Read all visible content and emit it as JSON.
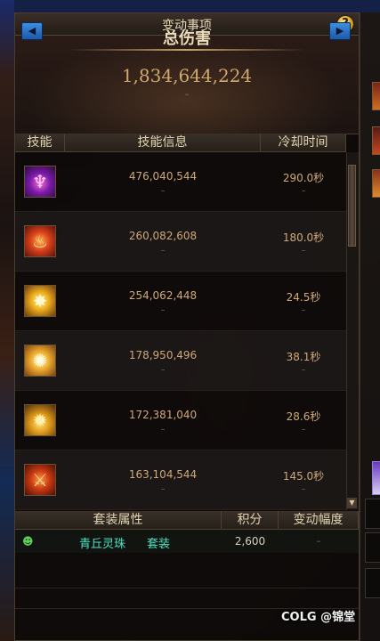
{
  "window": {
    "title": "变动事项"
  },
  "summary": {
    "title": "总伤害",
    "total_damage": "1,834,644,224",
    "delta": "–"
  },
  "skills_table": {
    "headers": {
      "skill": "技能",
      "info": "技能信息",
      "cooldown": "冷却时间"
    },
    "rows": [
      {
        "icon": "purple-demon-skill-icon",
        "damage": "476,040,544",
        "damage_delta": "–",
        "cooldown": "290.0秒",
        "cooldown_delta": "–"
      },
      {
        "icon": "flame-beast-skill-icon",
        "damage": "260,082,608",
        "damage_delta": "–",
        "cooldown": "180.0秒",
        "cooldown_delta": "–"
      },
      {
        "icon": "golden-burst-skill-icon",
        "damage": "254,062,448",
        "damage_delta": "–",
        "cooldown": "24.5秒",
        "cooldown_delta": "–"
      },
      {
        "icon": "starburst-skill-icon",
        "damage": "178,950,496",
        "damage_delta": "–",
        "cooldown": "38.1秒",
        "cooldown_delta": "–"
      },
      {
        "icon": "spirit-flame-skill-icon",
        "damage": "172,381,040",
        "damage_delta": "–",
        "cooldown": "28.6秒",
        "cooldown_delta": "–"
      },
      {
        "icon": "fire-slash-skill-icon",
        "damage": "163,104,544",
        "damage_delta": "–",
        "cooldown": "145.0秒",
        "cooldown_delta": "–"
      }
    ]
  },
  "set_table": {
    "headers": {
      "attribute": "套装属性",
      "points": "积分",
      "change": "变动幅度"
    },
    "row": {
      "icon": "fox-mask-icon",
      "name": "青丘灵珠",
      "tag": "套装",
      "points": "2,600",
      "change": "–"
    }
  },
  "watermark": "COLG @锦堂",
  "colors": {
    "gold_text": "#cfa877",
    "set_name": "#4fe0c0",
    "header_bg": "#3a3129"
  }
}
